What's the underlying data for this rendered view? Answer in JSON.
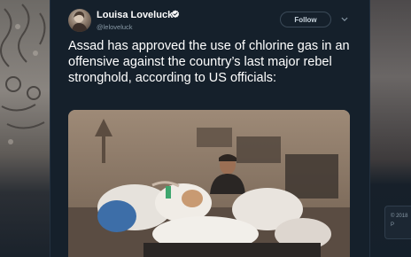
{
  "tweet": {
    "author_name": "Louisa Loveluck",
    "author_handle": "@leloveluck",
    "follow_label": "Follow",
    "text": "Assad has approved the use of chlorine gas in an offensive against the country’s last major rebel stronghold, according to US officials:",
    "avatar_icon": "profile-photo",
    "verified_icon": "verified-badge-icon",
    "menu_icon": "chevron-down-icon",
    "photo_description_icon": "attached-photo"
  },
  "footer": {
    "copyright": "© 2018",
    "truncated": "P"
  },
  "colors": {
    "background": "#15202b",
    "text": "#ffffff",
    "muted": "#8899a6",
    "verified": "#1da1f2"
  }
}
